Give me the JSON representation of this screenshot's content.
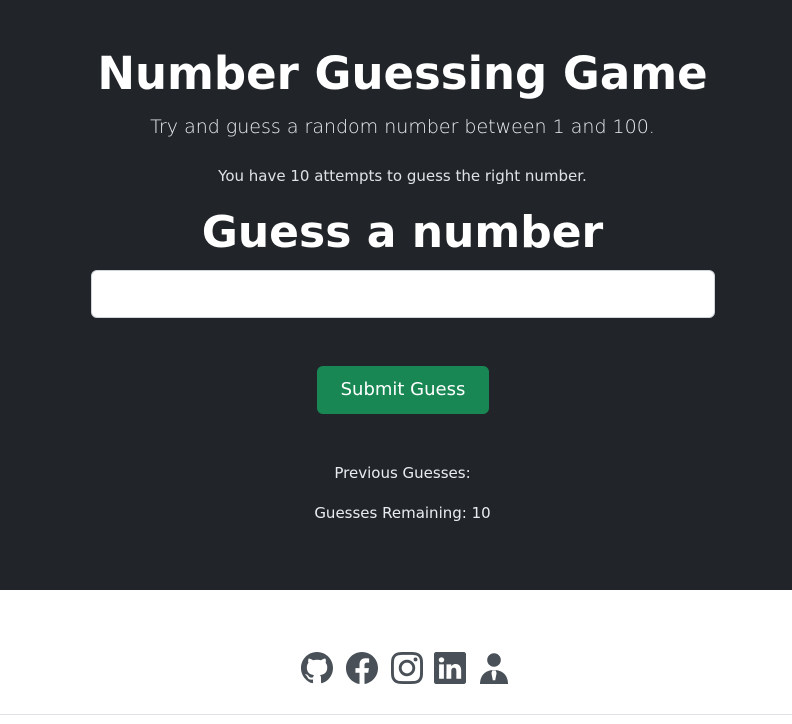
{
  "game": {
    "title": "Number Guessing Game",
    "lead": "Try and guess a random number between 1 and 100.",
    "attempts_info": "You have 10 attempts to guess the right number.",
    "guess_heading": "Guess a number",
    "guess_input": {
      "value": "",
      "placeholder": ""
    },
    "submit_label": "Submit Guess",
    "previous_guesses_label": "Previous Guesses:",
    "remaining_text": "Guesses Remaining: 10"
  },
  "footer": {
    "social_links": [
      {
        "icon": "github-icon"
      },
      {
        "icon": "facebook-icon"
      },
      {
        "icon": "instagram-icon"
      },
      {
        "icon": "linkedin-icon"
      },
      {
        "icon": "person-icon"
      }
    ]
  },
  "colors": {
    "background_dark": "#212529",
    "accent_green": "#198754",
    "icon_gray": "#495057"
  }
}
